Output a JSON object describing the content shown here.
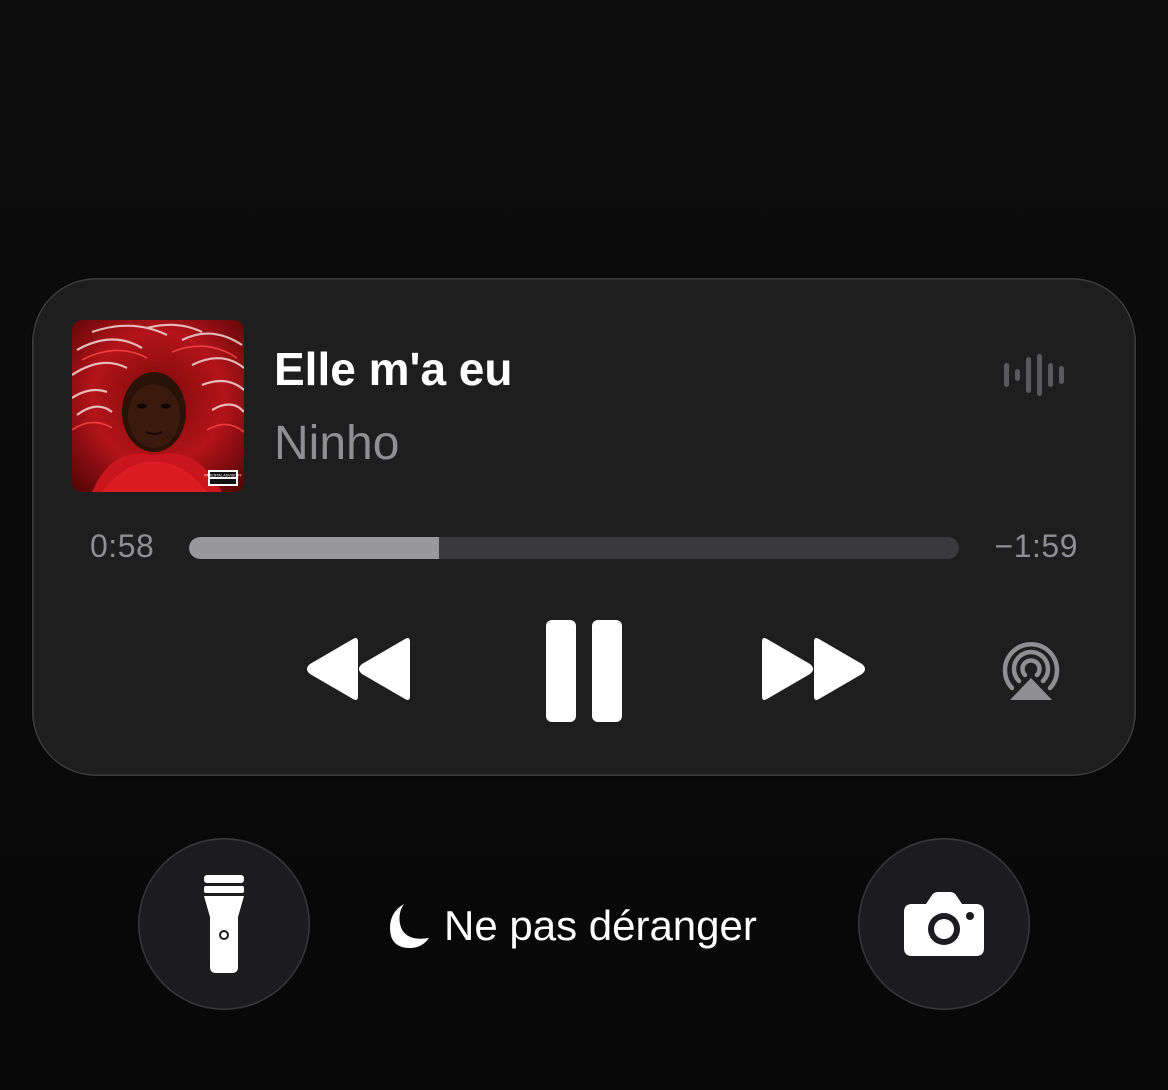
{
  "now_playing": {
    "title": "Elle m'a eu",
    "artist": "Ninho",
    "artwork": "album-cover-red-feathers",
    "elapsed": "0:58",
    "remaining": "−1:59",
    "progress_fraction": 0.325,
    "parental_advisory": "PARENTAL ADVISORY"
  },
  "controls": {
    "rewind_icon": "backward-icon",
    "pause_icon": "pause-icon",
    "forward_icon": "forward-icon",
    "airplay_icon": "airplay-icon",
    "waveform_icon": "waveform-icon"
  },
  "bottom_bar": {
    "focus_mode_label": "Ne pas déranger",
    "focus_icon": "moon-icon",
    "left_button_icon": "flashlight-icon",
    "right_button_icon": "camera-icon"
  },
  "colors": {
    "background": "#0b0b0b",
    "card": "#1e1e1e",
    "secondary_text": "#8e8e93",
    "progress_fill": "#98989d",
    "progress_track": "#3a3a3c"
  }
}
